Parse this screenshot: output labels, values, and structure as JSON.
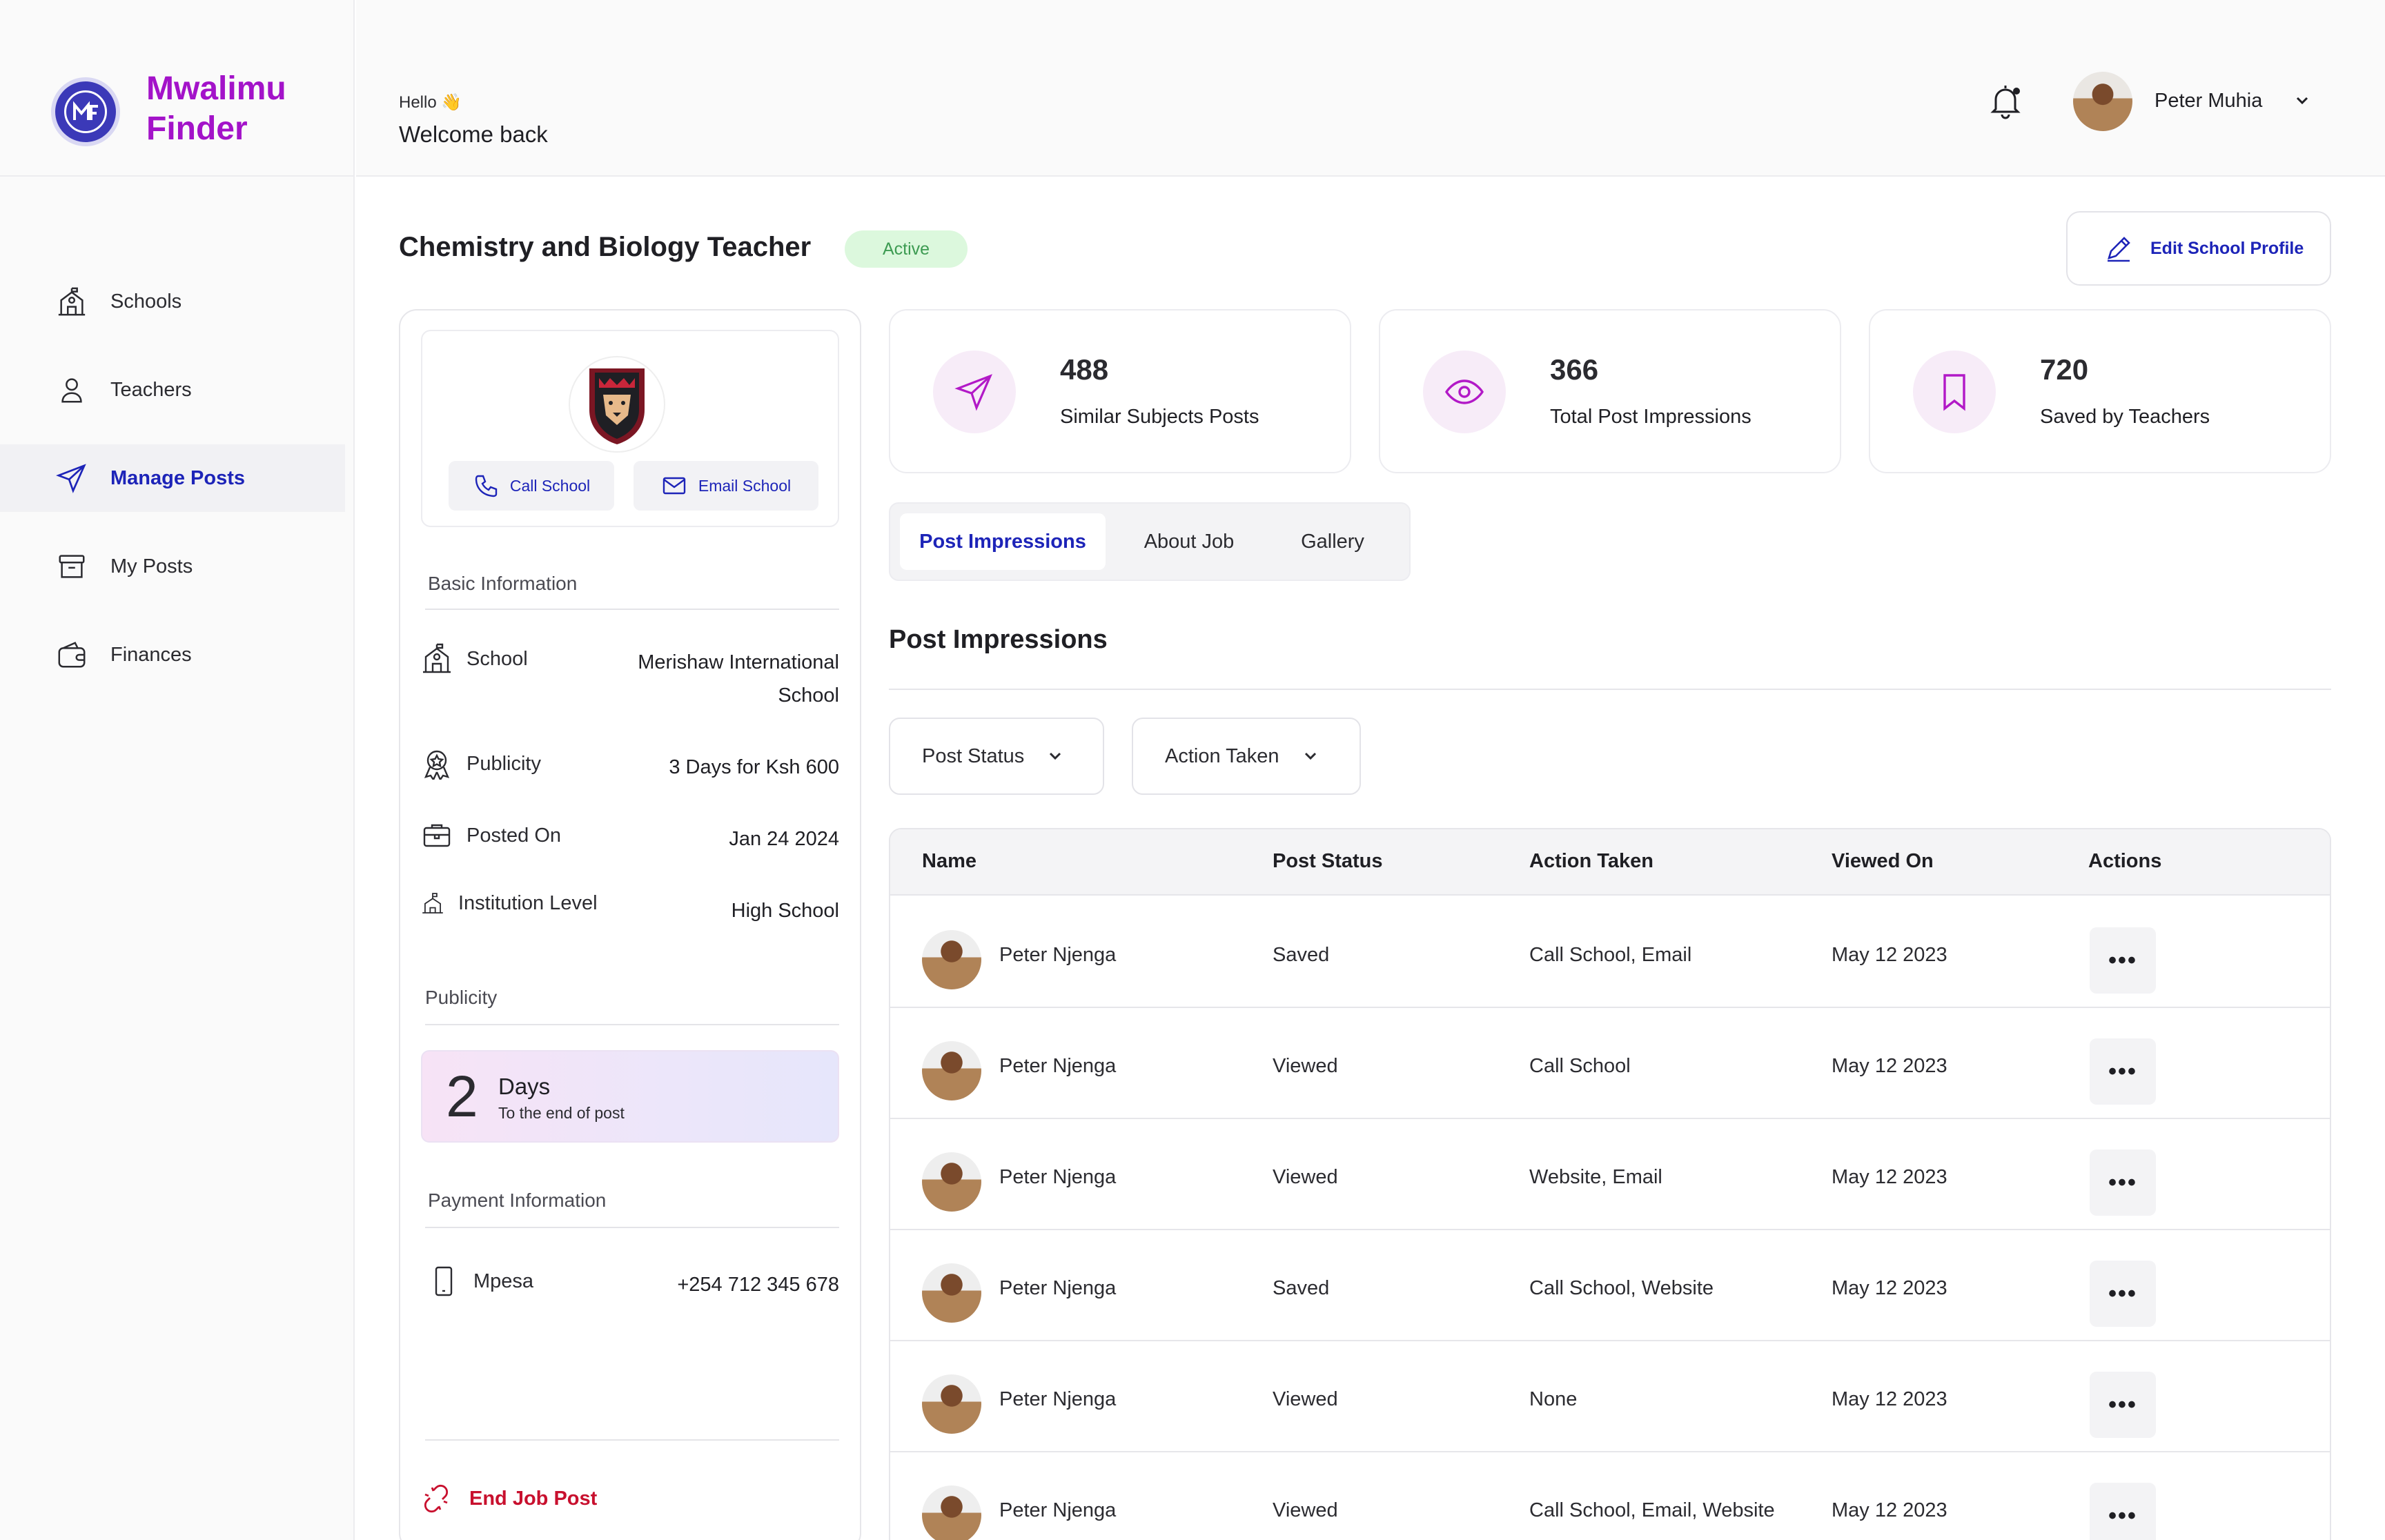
{
  "brand": {
    "name": "Mwalimu Finder",
    "logo_icon": "mwalimu-finder-logo"
  },
  "sidebar": {
    "items": [
      {
        "label": "Schools",
        "icon": "school-building-icon",
        "active": false
      },
      {
        "label": "Teachers",
        "icon": "user-icon",
        "active": false
      },
      {
        "label": "Manage Posts",
        "icon": "send-icon",
        "active": true
      },
      {
        "label": "My Posts",
        "icon": "archive-icon",
        "active": false
      },
      {
        "label": "Finances",
        "icon": "wallet-icon",
        "active": false
      }
    ]
  },
  "header": {
    "greeting": "Hello 👋",
    "welcome": "Welcome back",
    "user_name": "Peter Muhia"
  },
  "post": {
    "title": "Chemistry and Biology Teacher",
    "status": "Active",
    "edit_label": "Edit School Profile"
  },
  "school_card": {
    "call_label": "Call School",
    "email_label": "Email School",
    "basic_info_label": "Basic Information",
    "rows": [
      {
        "label": "School",
        "value": "Merishaw International School"
      },
      {
        "label": "Publicity",
        "value": "3 Days for Ksh 600"
      },
      {
        "label": "Posted On",
        "value": "Jan 24 2024"
      },
      {
        "label": "Institution Level",
        "value": "High School"
      }
    ],
    "publicity_label": "Publicity",
    "days_number": "2",
    "days_word": "Days",
    "days_sub": "To the end of post",
    "payment_label": "Payment Information",
    "payment_method": "Mpesa",
    "payment_value": "+254 712 345 678",
    "end_label": "End Job Post"
  },
  "stats": [
    {
      "value": "488",
      "label": "Similar Subjects Posts",
      "icon": "send-icon"
    },
    {
      "value": "366",
      "label": "Total Post Impressions",
      "icon": "eye-icon"
    },
    {
      "value": "720",
      "label": "Saved by Teachers",
      "icon": "bookmark-icon"
    }
  ],
  "tabs": [
    {
      "label": "Post Impressions",
      "active": true
    },
    {
      "label": "About Job",
      "active": false
    },
    {
      "label": "Gallery",
      "active": false
    }
  ],
  "impressions": {
    "heading": "Post Impressions",
    "filters": [
      "Post Status",
      "Action Taken"
    ],
    "columns": [
      "Name",
      "Post Status",
      "Action Taken",
      "Viewed On",
      "Actions"
    ],
    "rows": [
      {
        "name": "Peter Njenga",
        "status": "Saved",
        "action": "Call School, Email",
        "viewed": "May 12 2023"
      },
      {
        "name": "Peter Njenga",
        "status": "Viewed",
        "action": "Call School",
        "viewed": "May 12 2023"
      },
      {
        "name": "Peter Njenga",
        "status": "Viewed",
        "action": "Website, Email",
        "viewed": "May 12 2023"
      },
      {
        "name": "Peter Njenga",
        "status": "Saved",
        "action": "Call School, Website",
        "viewed": "May 12 2023"
      },
      {
        "name": "Peter Njenga",
        "status": "Viewed",
        "action": "None",
        "viewed": "May 12 2023"
      },
      {
        "name": "Peter Njenga",
        "status": "Viewed",
        "action": "Call School, Email, Website",
        "viewed": "May 12 2023"
      }
    ],
    "more_symbol": "•••"
  },
  "colors": {
    "brand": "#a313c9",
    "accent": "#1d24b8",
    "danger": "#c8102e",
    "active_badge_bg": "#dcf8dd",
    "active_badge_text": "#3d9b52"
  }
}
